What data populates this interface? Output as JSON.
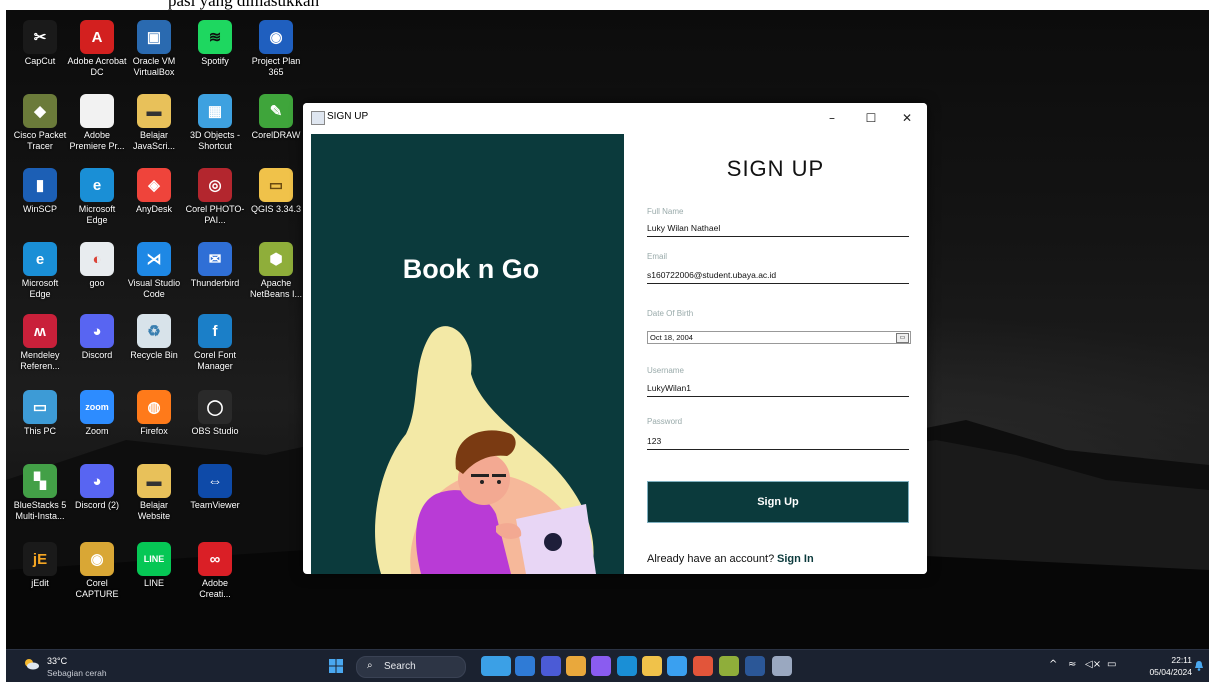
{
  "top_caption": "pasi yang dimasukkan",
  "desktop_icons": [
    {
      "label": "CapCut",
      "color": "#1a1a1a",
      "glyph": "✂",
      "fg": "#fff",
      "col": 0,
      "row": 0
    },
    {
      "label": "Adobe Acrobat DC",
      "color": "#d3201f",
      "glyph": "A",
      "fg": "#fff",
      "col": 1,
      "row": 0
    },
    {
      "label": "Oracle VM VirtualBox",
      "color": "#2a6ab0",
      "glyph": "▣",
      "fg": "#fff",
      "col": 2,
      "row": 0
    },
    {
      "label": "Spotify",
      "color": "#1ed760",
      "glyph": "≋",
      "fg": "#0f0f0f",
      "col": 3,
      "row": 0
    },
    {
      "label": "Project Plan 365",
      "color": "#1f5fbf",
      "glyph": "◉",
      "fg": "#fff",
      "col": 4,
      "row": 0
    },
    {
      "label": "Cisco Packet Tracer",
      "color": "#6b7b3a",
      "glyph": "◆",
      "fg": "#fff",
      "col": 0,
      "row": 1
    },
    {
      "label": "Adobe Premiere Pr...",
      "color": "#f2f2f2",
      "glyph": "",
      "fg": "#555",
      "col": 1,
      "row": 1
    },
    {
      "label": "Belajar JavaScri...",
      "color": "#e8c15a",
      "glyph": "▬",
      "fg": "#333",
      "col": 2,
      "row": 1
    },
    {
      "label": "3D Objects - Shortcut",
      "color": "#3ea1e0",
      "glyph": "▦",
      "fg": "#fff",
      "col": 3,
      "row": 1
    },
    {
      "label": "CorelDRAW",
      "color": "#3fa53b",
      "glyph": "✎",
      "fg": "#fff",
      "col": 4,
      "row": 1
    },
    {
      "label": "WinSCP",
      "color": "#1c5fb5",
      "glyph": "▮",
      "fg": "#fff",
      "col": 0,
      "row": 2
    },
    {
      "label": "Microsoft Edge",
      "color": "#1a8fd6",
      "glyph": "e",
      "fg": "#fff",
      "col": 1,
      "row": 2
    },
    {
      "label": "AnyDesk",
      "color": "#ef443b",
      "glyph": "◈",
      "fg": "#fff",
      "col": 2,
      "row": 2
    },
    {
      "label": "Corel PHOTO-PAI...",
      "color": "#b3262e",
      "glyph": "◎",
      "fg": "#fff",
      "col": 3,
      "row": 2
    },
    {
      "label": "QGIS 3.34.3",
      "color": "#f0c24a",
      "glyph": "▭",
      "fg": "#6a4a10",
      "col": 4,
      "row": 2
    },
    {
      "label": "Microsoft Edge",
      "color": "#1a8fd6",
      "glyph": "e",
      "fg": "#fff",
      "col": 0,
      "row": 3
    },
    {
      "label": "goo",
      "color": "#e8ecef",
      "glyph": "◐",
      "fg": "#db4437",
      "col": 1,
      "row": 3
    },
    {
      "label": "Visual Studio Code",
      "color": "#1e88e5",
      "glyph": "⋊",
      "fg": "#fff",
      "col": 2,
      "row": 3
    },
    {
      "label": "Thunderbird",
      "color": "#2f6fd6",
      "glyph": "✉",
      "fg": "#fff",
      "col": 3,
      "row": 3
    },
    {
      "label": "Apache NetBeans I...",
      "color": "#8fae3a",
      "glyph": "⬢",
      "fg": "#fff",
      "col": 4,
      "row": 3
    },
    {
      "label": "Mendeley Referen...",
      "color": "#c9203a",
      "glyph": "ʍ",
      "fg": "#fff",
      "col": 0,
      "row": 4
    },
    {
      "label": "Discord",
      "color": "#5865f2",
      "glyph": "◕",
      "fg": "#fff",
      "col": 1,
      "row": 4
    },
    {
      "label": "Recycle Bin",
      "color": "#d8e3ea",
      "glyph": "♻",
      "fg": "#3a7fb0",
      "col": 2,
      "row": 4
    },
    {
      "label": "Corel Font Manager",
      "color": "#1b7fc8",
      "glyph": "f",
      "fg": "#fff",
      "col": 3,
      "row": 4
    },
    {
      "label": "This PC",
      "color": "#3d9bd6",
      "glyph": "▭",
      "fg": "#fff",
      "col": 0,
      "row": 5
    },
    {
      "label": "Zoom",
      "color": "#2d8cff",
      "glyph": "zoom",
      "fg": "#fff",
      "col": 1,
      "row": 5
    },
    {
      "label": "Firefox",
      "color": "#ff7a1a",
      "glyph": "◍",
      "fg": "#fff",
      "col": 2,
      "row": 5
    },
    {
      "label": "OBS Studio",
      "color": "#2a2a2a",
      "glyph": "◯",
      "fg": "#fff",
      "col": 3,
      "row": 5
    },
    {
      "label": "BlueStacks 5 Multi-Insta...",
      "color": "#43a047",
      "glyph": "▚",
      "fg": "#fff",
      "col": 0,
      "row": 6
    },
    {
      "label": "Discord (2)",
      "color": "#5865f2",
      "glyph": "◕",
      "fg": "#fff",
      "col": 1,
      "row": 6
    },
    {
      "label": "Belajar Website",
      "color": "#e8c15a",
      "glyph": "▬",
      "fg": "#333",
      "col": 2,
      "row": 6
    },
    {
      "label": "TeamViewer",
      "color": "#0e4aa8",
      "glyph": "⇔",
      "fg": "#fff",
      "col": 3,
      "row": 6
    },
    {
      "label": "jEdit",
      "color": "#1a1a1a",
      "glyph": "jE",
      "fg": "#f5a623",
      "col": 0,
      "row": 7
    },
    {
      "label": "Corel CAPTURE",
      "color": "#d9a735",
      "glyph": "◉",
      "fg": "#fff",
      "col": 1,
      "row": 7
    },
    {
      "label": "LINE",
      "color": "#06c755",
      "glyph": "LINE",
      "fg": "#fff",
      "col": 2,
      "row": 7
    },
    {
      "label": "Adobe Creati...",
      "color": "#da1f26",
      "glyph": "∞",
      "fg": "#fff",
      "col": 3,
      "row": 7
    }
  ],
  "window": {
    "title": "SIGN UP",
    "brand": "Book n Go",
    "form_title": "SIGN UP",
    "fields": {
      "full_name": {
        "label": "Full Name",
        "value": "Luky Wilan Nathael"
      },
      "email": {
        "label": "Email",
        "value": "s160722006@student.ubaya.ac.id"
      },
      "dob": {
        "label": "Date Of Birth",
        "value": "Oct 18, 2004"
      },
      "username": {
        "label": "Username",
        "value": "LukyWilan1"
      },
      "password": {
        "label": "Password",
        "value": "123"
      }
    },
    "signup_button": "Sign Up",
    "already_text": "Already have an account?",
    "signin_link": "Sign In",
    "colors": {
      "panel": "#0b3a3c"
    }
  },
  "taskbar": {
    "temperature": "33°C",
    "weather": "Sebagian cerah",
    "search_label": "Search",
    "time": "22:11",
    "date": "05/04/2024",
    "pinned_icons": [
      "landscape-app-icon",
      "explorer-icon",
      "teams-icon",
      "chrome-icon",
      "visual-studio-icon",
      "edge-icon",
      "file-manager-icon",
      "chrome-canary-icon",
      "presentation-icon",
      "netbeans-icon",
      "word-icon",
      "java-window-icon"
    ]
  }
}
